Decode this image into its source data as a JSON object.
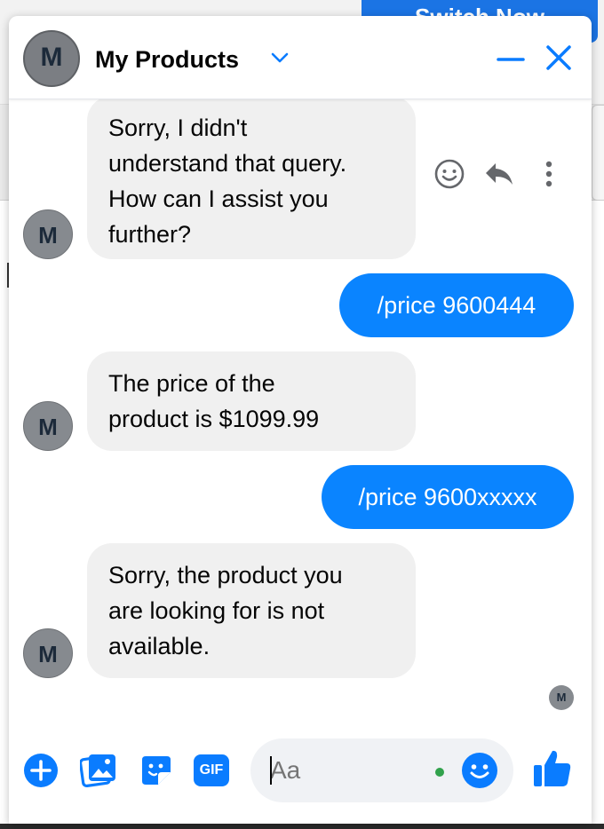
{
  "background": {
    "switch_button_label": "Switch Now"
  },
  "header": {
    "avatar_letter": "M",
    "title": "My Products"
  },
  "messages": [
    {
      "from": "bot",
      "lines": [
        "Sorry, I didn't",
        "understand that query.",
        "How can I assist you",
        "further?"
      ]
    },
    {
      "from": "user",
      "text": "/price 9600444"
    },
    {
      "from": "bot",
      "lines": [
        "The price of the",
        "product is $1099.99"
      ]
    },
    {
      "from": "user",
      "text": "/price 9600xxxxx"
    },
    {
      "from": "bot",
      "lines": [
        "Sorry, the product you",
        "are looking for is not",
        "available."
      ]
    }
  ],
  "bot_avatar_letter": "M",
  "seen_avatar_letter": "M",
  "message_actions": [
    "react-icon",
    "reply-icon",
    "more-icon"
  ],
  "composer": {
    "placeholder": "Aa",
    "icons": [
      "plus-icon",
      "photo-icon",
      "sticker-icon",
      "gif-icon",
      "emoji-icon",
      "like-icon"
    ],
    "gif_label": "GIF"
  },
  "colors": {
    "accent": "#0a84ff",
    "incoming_bubble": "#f0f0f0",
    "online_dot": "#31a24c"
  }
}
